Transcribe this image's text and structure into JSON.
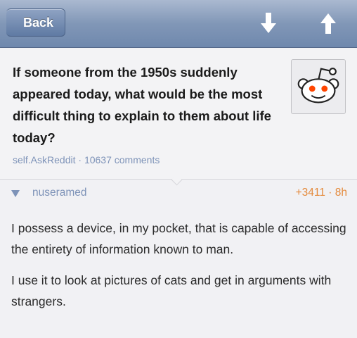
{
  "navbar": {
    "back_label": "Back",
    "downvote_icon": "arrow-down-icon",
    "upvote_icon": "arrow-up-icon"
  },
  "post": {
    "title": "If someone from the 1950s suddenly appeared today, what would be the most difficult thing to explain to them about life today?",
    "domain": "self.AskReddit",
    "separator": "·",
    "comments": "10637 comments",
    "thumbnail_icon": "reddit-alien-icon"
  },
  "comment": {
    "collapse_icon": "triangle-down-icon",
    "author": "nuseramed",
    "score": "+3411",
    "separator": "·",
    "age": "8h",
    "paragraphs": [
      "I possess a device, in my pocket, that is capable of accessing the entirety of information known to man.",
      "I use it to look at pictures of cats and get in arguments with strangers."
    ]
  },
  "colors": {
    "nav_gradient_top": "#aab9d0",
    "nav_gradient_bottom": "#6f88ad",
    "link_blue": "#7e93b8",
    "score_orange": "#e48a3c",
    "text_dark": "#1a1a1a"
  }
}
